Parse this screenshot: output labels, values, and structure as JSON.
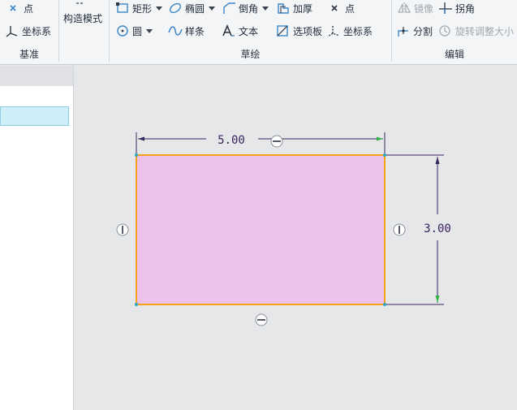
{
  "ribbon": {
    "datum_group": {
      "label": "基准",
      "point": "点",
      "csys": "坐标系"
    },
    "construction_mode": "构造模式",
    "sketch_group": {
      "label": "草绘",
      "rectangle": "矩形",
      "ellipse": "椭圆",
      "chamfer": "倒角",
      "thicken": "加厚",
      "point": "点",
      "circle": "圆",
      "spline": "样条",
      "text": "文本",
      "palette": "选项板",
      "csys": "坐标系"
    },
    "edit_group": {
      "label": "编辑",
      "mirror": "镜像",
      "corner": "拐角",
      "divide": "分割",
      "rotate_resize": "旋转调整大小"
    }
  },
  "sketch": {
    "width_dim": "5.00",
    "height_dim": "3.00",
    "fill_color": "#ecc2ea",
    "edge_color": "#f5a21a",
    "dim_color": "#3a235c"
  }
}
